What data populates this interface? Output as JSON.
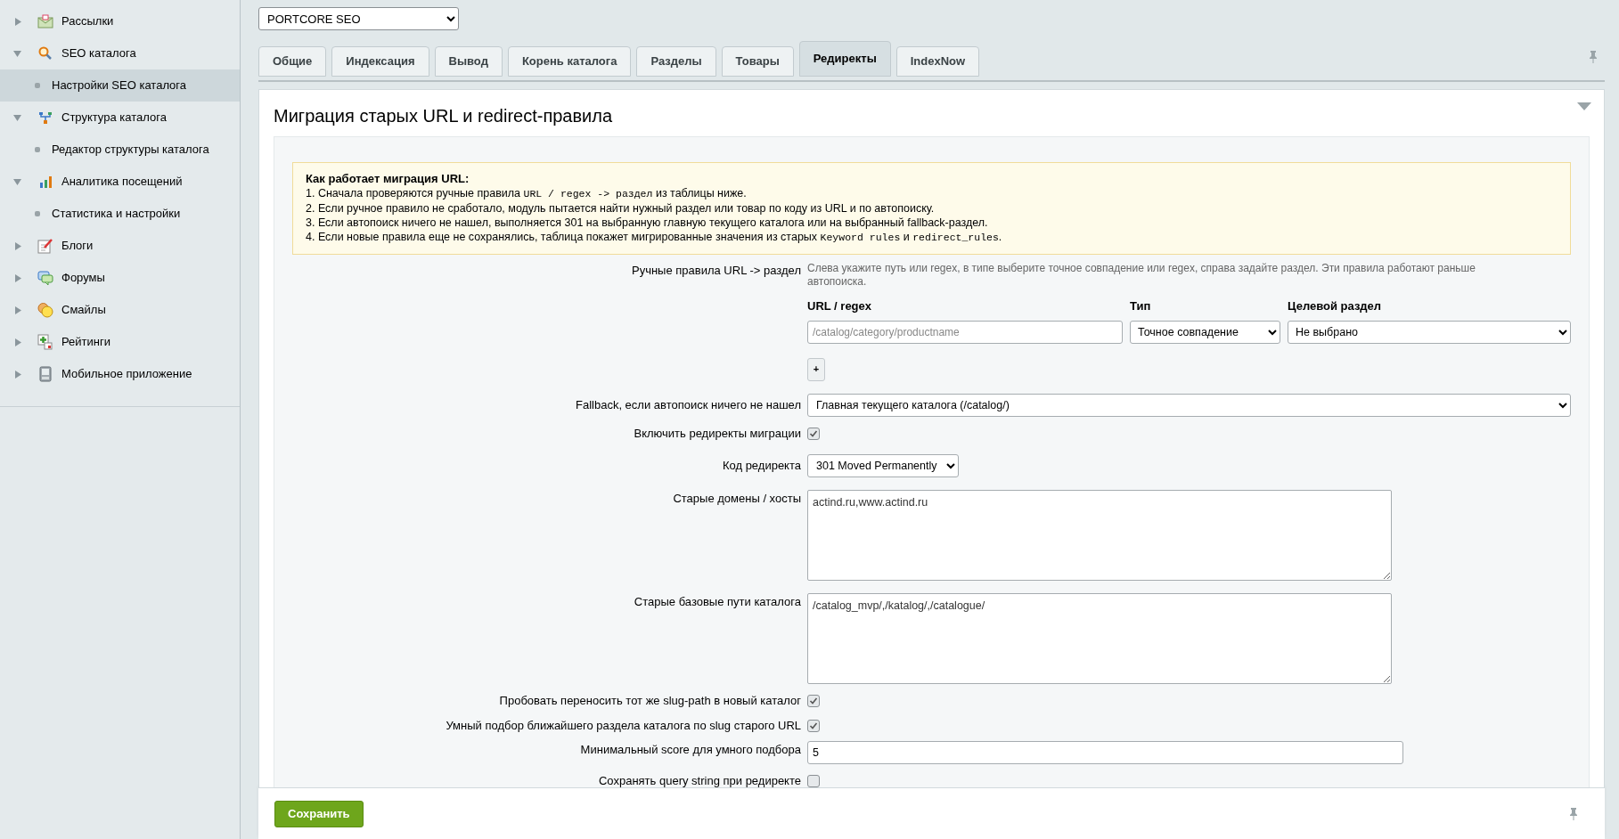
{
  "sidebar": {
    "items": [
      {
        "label": "Рассылки",
        "expanded": false
      },
      {
        "label": "SEO каталога",
        "expanded": true,
        "children": [
          {
            "label": "Настройки SEO каталога",
            "selected": true
          }
        ]
      },
      {
        "label": "Структура каталога",
        "expanded": true,
        "children": [
          {
            "label": "Редактор структуры каталога",
            "selected": false
          }
        ]
      },
      {
        "label": "Аналитика посещений",
        "expanded": true,
        "children": [
          {
            "label": "Статистика и настройки",
            "selected": false
          }
        ]
      },
      {
        "label": "Блоги",
        "expanded": false
      },
      {
        "label": "Форумы",
        "expanded": false
      },
      {
        "label": "Смайлы",
        "expanded": false
      },
      {
        "label": "Рейтинги",
        "expanded": false
      },
      {
        "label": "Мобильное приложение",
        "expanded": false
      }
    ]
  },
  "site_select": {
    "value": "PORTCORE SEO"
  },
  "tabs": [
    {
      "label": "Общие",
      "selected": false
    },
    {
      "label": "Индексация",
      "selected": false
    },
    {
      "label": "Вывод",
      "selected": false
    },
    {
      "label": "Корень каталога",
      "selected": false
    },
    {
      "label": "Разделы",
      "selected": false
    },
    {
      "label": "Товары",
      "selected": false
    },
    {
      "label": "Редиректы",
      "selected": true
    },
    {
      "label": "IndexNow",
      "selected": false
    }
  ],
  "section": {
    "title": "Миграция старых URL и redirect-правила"
  },
  "info": {
    "title": "Как работает миграция URL:",
    "lines": [
      [
        {
          "kind": "text",
          "text": "1. Сначала проверяются ручные правила "
        },
        {
          "kind": "code",
          "text": "URL / regex -> раздел"
        },
        {
          "kind": "text",
          "text": " из таблицы ниже."
        }
      ],
      [
        {
          "kind": "text",
          "text": "2. Если ручное правило не сработало, модуль пытается найти нужный раздел или товар по коду из URL и по автопоиску."
        }
      ],
      [
        {
          "kind": "text",
          "text": "3. Если автопоиск ничего не нашел, выполняется 301 на выбранную главную текущего каталога или на выбранный fallback-раздел."
        }
      ],
      [
        {
          "kind": "text",
          "text": "4. Если новые правила еще не сохранялись, таблица покажет мигрированные значения из старых "
        },
        {
          "kind": "code",
          "text": "Keyword rules"
        },
        {
          "kind": "text",
          "text": " и "
        },
        {
          "kind": "code",
          "text": "redirect_rules"
        },
        {
          "kind": "text",
          "text": "."
        }
      ]
    ]
  },
  "form": [
    {
      "kind": "rules",
      "label": "Ручные правила URL -> раздел",
      "hint": "Слева укажите путь или regex, в типе выберите точное совпадение или regex, справа задайте раздел. Эти правила работают раньше автопоиска.",
      "columns": [
        "URL / regex",
        "Тип",
        "Целевой раздел"
      ],
      "url_placeholder": "/catalog/category/productname",
      "type": "Точное совпадение",
      "target": "Не выбрано",
      "add_button": "+"
    },
    {
      "kind": "select",
      "label": "Fallback, если автопоиск ничего не нашел",
      "value": "Главная текущего каталога (/catalog/)",
      "wide": true
    },
    {
      "kind": "checkbox",
      "label": "Включить редиректы миграции",
      "checked": true
    },
    {
      "kind": "select",
      "label": "Код редиректа",
      "value": "301 Moved Permanently",
      "wide": false
    },
    {
      "kind": "textarea",
      "label": "Старые домены / хосты",
      "value": "actind.ru,www.actind.ru"
    },
    {
      "kind": "textarea",
      "label": "Старые базовые пути каталога",
      "value": "/catalog_mvp/,/katalog/,/catalogue/"
    },
    {
      "kind": "checkbox",
      "label": "Пробовать переносить тот же slug-path в новый каталог",
      "checked": true
    },
    {
      "kind": "checkbox",
      "label": "Умный подбор ближайшего раздела каталога по slug старого URL",
      "checked": true
    },
    {
      "kind": "input",
      "label": "Минимальный score для умного подбора",
      "value": "5"
    },
    {
      "kind": "checkbox",
      "label": "Сохранять query string при редиректе",
      "checked": false
    }
  ],
  "save_button": "Сохранить"
}
